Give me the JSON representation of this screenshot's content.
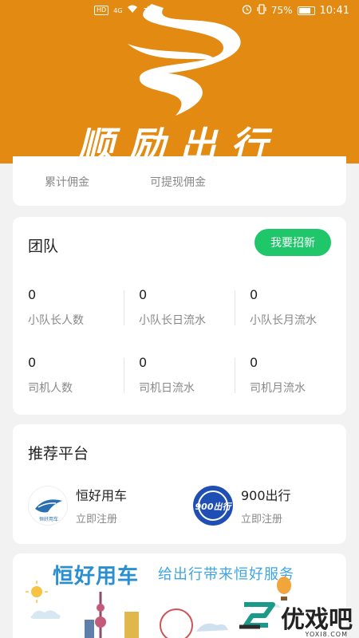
{
  "status_bar": {
    "network": "HD",
    "signal": "4G",
    "extra": "文",
    "battery_percent": "75%",
    "time": "10:41"
  },
  "banner": {
    "title": "顺励出行",
    "background_color": "#e28a12"
  },
  "commission": {
    "cumulative_label": "累计佣金",
    "withdrawable_label": "可提现佣金"
  },
  "team": {
    "title": "团队",
    "recruit_button": "我要招新",
    "stats": [
      {
        "value": "0",
        "label": "小队长人数"
      },
      {
        "value": "0",
        "label": "小队长日流水"
      },
      {
        "value": "0",
        "label": "小队长月流水"
      },
      {
        "value": "0",
        "label": "司机人数"
      },
      {
        "value": "0",
        "label": "司机日流水"
      },
      {
        "value": "0",
        "label": "司机月流水"
      }
    ]
  },
  "platforms": {
    "title": "推荐平台",
    "items": [
      {
        "name": "恒好用车",
        "action": "立即注册",
        "logo_text": "恒好用车"
      },
      {
        "name": "900出行",
        "action": "立即注册",
        "logo_text": "900出行"
      }
    ]
  },
  "ad_banner": {
    "title": "恒好用车",
    "subtitle": "给出行带来恒好服务"
  },
  "watermark": {
    "text": "优戏吧",
    "url": "YOXI8.COM"
  },
  "colors": {
    "accent_green": "#1fc66a",
    "brand_orange": "#e28a12",
    "ad_blue": "#2a8fd0"
  }
}
